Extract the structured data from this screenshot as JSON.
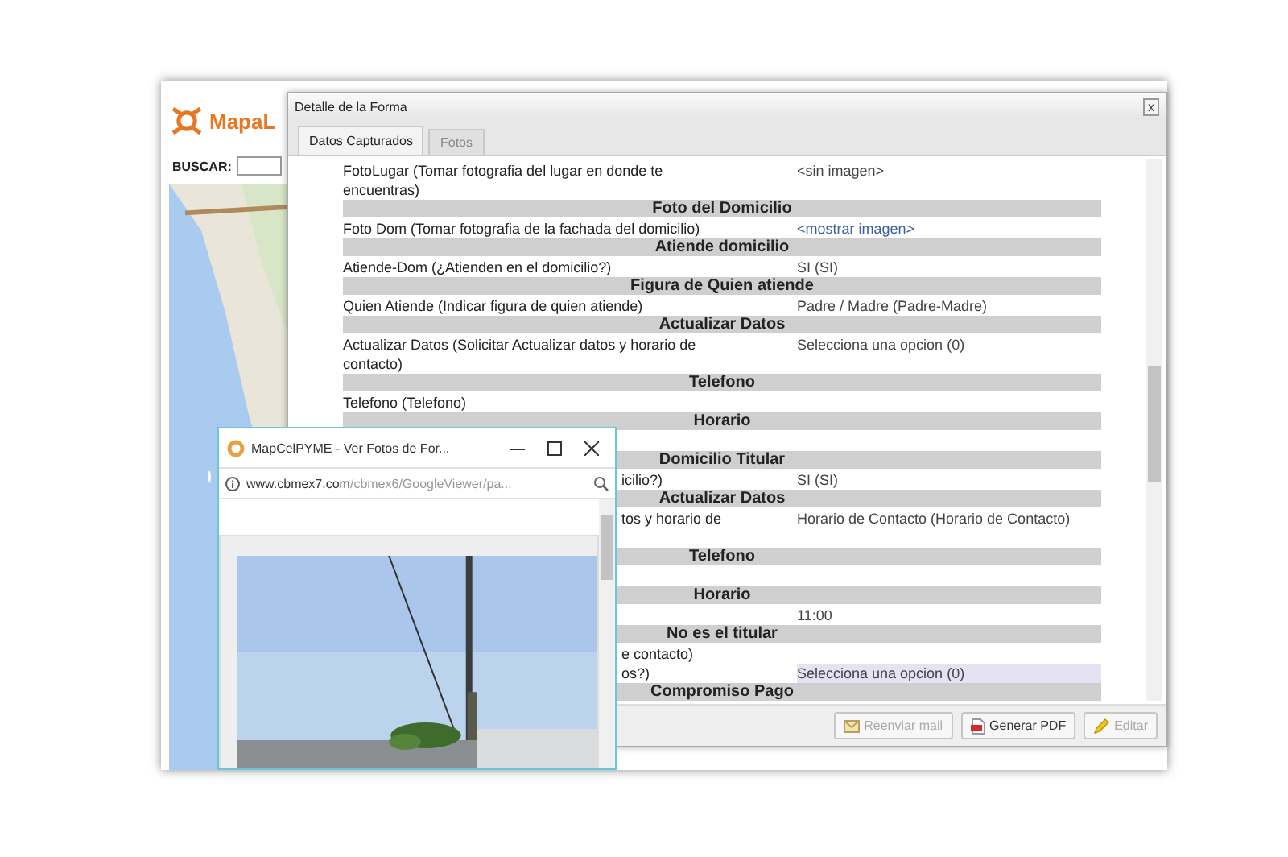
{
  "background_app": {
    "logo": "MapaL",
    "search_label": "BUSCAR:"
  },
  "detail_window": {
    "title": "Detalle de la Forma",
    "close": "x",
    "tabs": [
      {
        "label": "Datos Capturados",
        "selected": true
      },
      {
        "label": "Fotos",
        "selected": false
      }
    ],
    "rows": [
      {
        "kind": "field",
        "label": "FotoLugar (Tomar fotografia del lugar en donde te encuentras)",
        "value": "<sin imagen>",
        "link": false,
        "highlighted": false
      },
      {
        "kind": "section",
        "title": "Foto del Domicilio"
      },
      {
        "kind": "field",
        "label": "Foto Dom (Tomar fotografia de la fachada del domicilio)",
        "value": "<mostrar imagen>",
        "link": true,
        "highlighted": false
      },
      {
        "kind": "section",
        "title": "Atiende domicilio"
      },
      {
        "kind": "field",
        "label": "Atiende-Dom (¿Atienden en el domicilio?)",
        "value": "SI (SI)",
        "link": false,
        "highlighted": false
      },
      {
        "kind": "section",
        "title": "Figura de Quien atiende"
      },
      {
        "kind": "field",
        "label": "Quien Atiende (Indicar figura de quien atiende)",
        "value": "Padre / Madre (Padre-Madre)",
        "link": false,
        "highlighted": false
      },
      {
        "kind": "section",
        "title": "Actualizar Datos"
      },
      {
        "kind": "field",
        "label": "Actualizar Datos (Solicitar Actualizar datos y horario de contacto)",
        "value": "Selecciona una opcion (0)",
        "link": false,
        "highlighted": false
      },
      {
        "kind": "section",
        "title": "Telefono"
      },
      {
        "kind": "field",
        "label": "Telefono (Telefono)",
        "highlighted": false
      },
      {
        "kind": "section",
        "title": "Horario"
      },
      {
        "kind": "blank"
      },
      {
        "kind": "section",
        "title": "Domicilio Titular"
      },
      {
        "kind": "partial_field",
        "label": "icilio?)",
        "value": "SI (SI)",
        "link": false,
        "highlighted": false
      },
      {
        "kind": "section",
        "title": "Actualizar Datos"
      },
      {
        "kind": "tall_partial_field",
        "label": "tos y horario de",
        "value": "Horario de Contacto (Horario de Contacto)",
        "link": false,
        "highlighted": false
      },
      {
        "kind": "section",
        "title": "Telefono"
      },
      {
        "kind": "blank"
      },
      {
        "kind": "section",
        "title": "Horario"
      },
      {
        "kind": "field",
        "value": "11:00",
        "link": false,
        "highlighted": false
      },
      {
        "kind": "section",
        "title": "No es el titular"
      },
      {
        "kind": "partial_field",
        "label": "e contacto)",
        "highlighted": false
      },
      {
        "kind": "partial_field",
        "label": "os?)",
        "value": "Selecciona una opcion (0)",
        "link": false,
        "highlighted": true
      },
      {
        "kind": "section",
        "title": "Compromiso Pago"
      }
    ],
    "buttons": [
      {
        "label": "Reenviar mail",
        "disabled": true
      },
      {
        "label": "Generar PDF",
        "disabled": false
      },
      {
        "label": "Editar",
        "disabled": true
      }
    ]
  },
  "popup_window": {
    "title": "MapCelPYME - Ver Fotos de For...",
    "url_host": "www.cbmex7.com",
    "url_path": "/cbmex6/GoogleViewer/pa..."
  }
}
